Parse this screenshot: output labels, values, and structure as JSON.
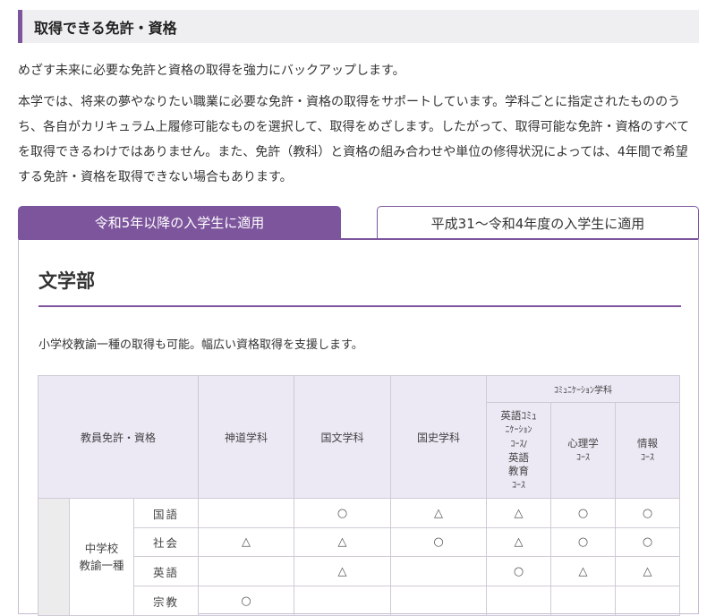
{
  "section": {
    "heading": "取得できる免許・資格"
  },
  "intro": {
    "lead": "めざす未来に必要な免許と資格の取得を強力にバックアップします。",
    "body": "本学では、将来の夢やなりたい職業に必要な免許・資格の取得をサポートしています。学科ごとに指定されたもののうち、各自がカリキュラム上履修可能なものを選択して、取得をめざします。したがって、取得可能な免許・資格のすべてを取得できるわけではありません。また、免許（教科）と資格の組み合わせや単位の修得状況によっては、4年間で希望する免許・資格を取得できない場合もあります。"
  },
  "tabs": [
    {
      "label": "令和5年以降の入学生に適用",
      "active": true
    },
    {
      "label": "平成31～令和4年度の入学生に適用",
      "active": false
    }
  ],
  "faculty": {
    "title": "文学部",
    "description": "小学校教諭一種の取得も可能。幅広い資格取得を支援します。"
  },
  "table": {
    "corner_label": "教員免許・資格",
    "columns": [
      "神道学科",
      "国文学科",
      "国史学科"
    ],
    "group_label": "ｺﾐｭﾆｹｰｼｮﾝ学科",
    "subcolumns": [
      {
        "lines": [
          "英語ｺﾐｭ",
          "ﾆｹｰｼｮﾝ",
          "ｺｰｽ/",
          "英語",
          "教育",
          "ｺｰｽ"
        ]
      },
      {
        "lines": [
          "心理学",
          "ｺｰｽ"
        ]
      },
      {
        "lines": [
          "情報",
          "ｺｰｽ"
        ]
      }
    ],
    "license_label": "中学校\n教諭一種",
    "rows": [
      {
        "subject": "国語",
        "marks": [
          "",
          "○",
          "△",
          "△",
          "○",
          "○"
        ]
      },
      {
        "subject": "社会",
        "marks": [
          "△",
          "△",
          "○",
          "△",
          "○",
          "○"
        ]
      },
      {
        "subject": "英語",
        "marks": [
          "",
          "△",
          "",
          "○",
          "△",
          "△"
        ]
      },
      {
        "subject": "宗教",
        "marks": [
          "○",
          "",
          "",
          "",
          "",
          ""
        ]
      }
    ]
  },
  "colors": {
    "accent": "#7d559d",
    "header_bg": "#ece8f4",
    "heading_bg": "#efeef0"
  }
}
